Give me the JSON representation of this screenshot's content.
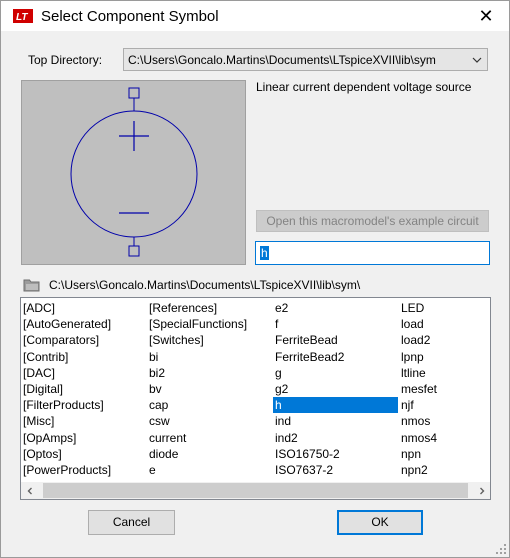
{
  "window": {
    "title": "Select Component Symbol",
    "close_icon": "close-icon",
    "app_icon": "ltspice-logo-icon"
  },
  "top_directory": {
    "label": "Top Directory:",
    "value": "C:\\Users\\Goncalo.Martins\\Documents\\LTspiceXVII\\lib\\sym"
  },
  "preview": {
    "description": "Linear current dependent voltage source",
    "symbol": "voltage-source-symbol"
  },
  "macro_button": {
    "label": "Open this macromodel's example circuit",
    "enabled": false
  },
  "search": {
    "value": "h"
  },
  "current_path": "C:\\Users\\Goncalo.Martins\\Documents\\LTspiceXVII\\lib\\sym\\",
  "file_list": {
    "columns": [
      [
        "[ADC]",
        "[AutoGenerated]",
        "[Comparators]",
        "[Contrib]",
        "[DAC]",
        "[Digital]",
        "[FilterProducts]",
        "[Misc]",
        "[OpAmps]",
        "[Optos]",
        "[PowerProducts]"
      ],
      [
        "[References]",
        "[SpecialFunctions]",
        "[Switches]",
        "bi",
        "bi2",
        "bv",
        "cap",
        "csw",
        "current",
        "diode",
        "e"
      ],
      [
        "e2",
        "f",
        "FerriteBead",
        "FerriteBead2",
        "g",
        "g2",
        "h",
        "ind",
        "ind2",
        "ISO16750-2",
        "ISO7637-2"
      ],
      [
        "LED",
        "load",
        "load2",
        "lpnp",
        "ltline",
        "mesfet",
        "njf",
        "nmos",
        "nmos4",
        "npn",
        "npn2"
      ]
    ],
    "selected": "h"
  },
  "buttons": {
    "cancel": "Cancel",
    "ok": "OK"
  },
  "colors": {
    "accent": "#0078d7",
    "preview_bg": "#bfbfbf",
    "symbol_stroke": "#0000aa"
  }
}
